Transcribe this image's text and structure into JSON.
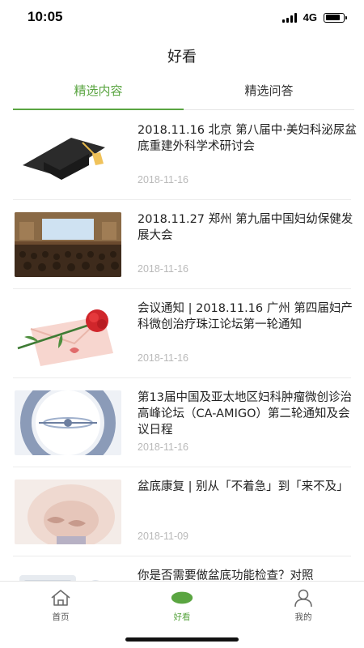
{
  "status_bar": {
    "time": "10:05",
    "network": "4G",
    "battery_level": 0.85
  },
  "header": {
    "title": "好看"
  },
  "tabs": [
    {
      "label": "精选内容",
      "active": true
    },
    {
      "label": "精选问答",
      "active": false
    }
  ],
  "articles": [
    {
      "title": " 2018.11.16 北京 第八届中·美妇科泌尿盆底重建外科学术研讨会",
      "date": "2018-11-16",
      "thumb_icon": "graduation-cap-icon"
    },
    {
      "title": "2018.11.27 郑州 第九届中国妇幼保健发展大会",
      "date": "2018-11-16",
      "thumb_icon": "conference-photo"
    },
    {
      "title": "会议通知 | 2018.11.16 广州 第四届妇产科微创治疗珠江论坛第一轮通知",
      "date": "2018-11-16",
      "thumb_icon": "envelope-carnation-icon"
    },
    {
      "title": "第13届中国及亚太地区妇科肿瘤微创诊治高峰论坛（CA-AMIGO）第二轮通知及会议日程",
      "date": "2018-11-16",
      "thumb_icon": "ca-amigo-logo"
    },
    {
      "title": "盆底康复 | 别从「不着急」到「来不及」",
      "date": "2018-11-09",
      "thumb_icon": "belly-photo"
    },
    {
      "title": "你是否需要做盆底功能检查？对照",
      "date": "",
      "thumb_icon": "badge-photo"
    }
  ],
  "bottom_nav": [
    {
      "label": "首页",
      "icon": "home-icon",
      "active": false
    },
    {
      "label": "好看",
      "icon": "leaf-icon",
      "active": true
    },
    {
      "label": "我的",
      "icon": "user-icon",
      "active": false
    }
  ],
  "colors": {
    "accent": "#5aa541",
    "date": "#b9b9b9",
    "divider": "#ececec"
  }
}
